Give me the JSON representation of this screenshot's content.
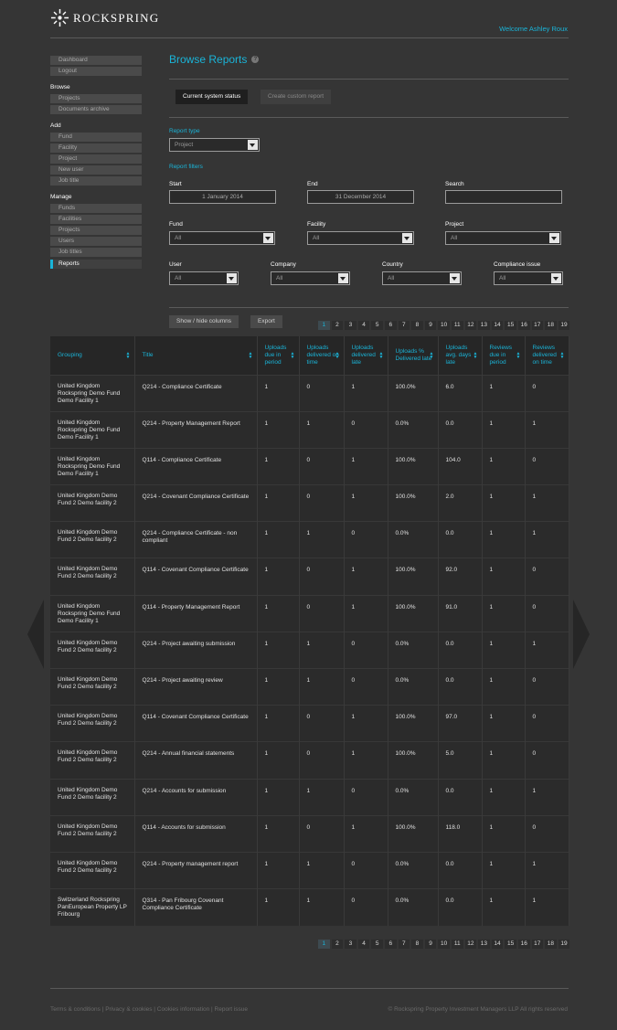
{
  "brand": {
    "name": "ROCKSPRING"
  },
  "header": {
    "welcome": "Welcome Ashley Roux"
  },
  "sidebar": {
    "top_items": [
      "Dashboard",
      "Logout"
    ],
    "browse_label": "Browse",
    "browse_items": [
      "Projects",
      "Documents archive"
    ],
    "add_label": "Add",
    "add_items": [
      "Fund",
      "Facility",
      "Project",
      "New user",
      "Job title"
    ],
    "manage_label": "Manage",
    "manage_items": [
      "Funds",
      "Facilities",
      "Projects",
      "Users",
      "Job titles",
      "Reports"
    ],
    "active_item": "Reports"
  },
  "main": {
    "title": "Browse Reports",
    "help_icon": "?",
    "tabs": [
      "Current system status",
      "Create custom report"
    ],
    "report_type_label": "Report type",
    "report_type_value": "Project",
    "report_filters_label": "Report filters",
    "filters": {
      "start_label": "Start",
      "start_value": "1 January 2014",
      "end_label": "End",
      "end_value": "31 December 2014",
      "search_label": "Search",
      "search_value": "",
      "fund_label": "Fund",
      "fund_value": "All",
      "facility_label": "Facility",
      "facility_value": "All",
      "project_label": "Project",
      "project_value": "All",
      "user_label": "User",
      "user_value": "All",
      "company_label": "Company",
      "company_value": "All",
      "country_label": "Country",
      "country_value": "All",
      "compliance_label": "Compliance issue",
      "compliance_value": "All"
    },
    "show_hide_label": "Show / hide columns",
    "export_label": "Export",
    "pages": [
      "1",
      "2",
      "3",
      "4",
      "5",
      "6",
      "7",
      "8",
      "9",
      "10",
      "11",
      "12",
      "13",
      "14",
      "15",
      "16",
      "17",
      "18",
      "19"
    ],
    "current_page": "1"
  },
  "table": {
    "columns": [
      "Grouping",
      "Title",
      "Uploads due in period",
      "Uploads delivered on time",
      "Uploads delivered late",
      "Uploads % Delivered late",
      "Uploads avg. days late",
      "Reviews due in period",
      "Reviews delivered on time"
    ],
    "rows": [
      [
        "United Kingdom Rockspring Demo Fund Demo Facility 1",
        "Q214 - Compliance Certificate",
        "1",
        "0",
        "1",
        "100.0%",
        "6.0",
        "1",
        "0"
      ],
      [
        "United Kingdom Rockspring Demo Fund Demo Facility 1",
        "Q214 - Property Management Report",
        "1",
        "1",
        "0",
        "0.0%",
        "0.0",
        "1",
        "1"
      ],
      [
        "United Kingdom Rockspring Demo Fund Demo Facility 1",
        "Q114 - Compliance Certificate",
        "1",
        "0",
        "1",
        "100.0%",
        "104.0",
        "1",
        "0"
      ],
      [
        "United Kingdom Demo Fund 2 Demo facility 2",
        "Q214 - Covenant Compliance Certificate",
        "1",
        "0",
        "1",
        "100.0%",
        "2.0",
        "1",
        "1"
      ],
      [
        "United Kingdom Demo Fund 2 Demo facility 2",
        "Q214 - Compliance Certificate - non compliant",
        "1",
        "1",
        "0",
        "0.0%",
        "0.0",
        "1",
        "1"
      ],
      [
        "United Kingdom Demo Fund 2 Demo facility 2",
        "Q114 - Covenant Compliance Certificate",
        "1",
        "0",
        "1",
        "100.0%",
        "92.0",
        "1",
        "0"
      ],
      [
        "United Kingdom Rockspring Demo Fund Demo Facility 1",
        "Q114 - Property Management Report",
        "1",
        "0",
        "1",
        "100.0%",
        "91.0",
        "1",
        "0"
      ],
      [
        "United Kingdom Demo Fund 2 Demo facility 2",
        "Q214 - Project awaiting submission",
        "1",
        "1",
        "0",
        "0.0%",
        "0.0",
        "1",
        "1"
      ],
      [
        "United Kingdom Demo Fund 2 Demo facility 2",
        "Q214 - Project awaiting review",
        "1",
        "1",
        "0",
        "0.0%",
        "0.0",
        "1",
        "0"
      ],
      [
        "United Kingdom Demo Fund 2 Demo facility 2",
        "Q114 - Covenant Compliance Certificate",
        "1",
        "0",
        "1",
        "100.0%",
        "97.0",
        "1",
        "0"
      ],
      [
        "United Kingdom Demo Fund 2 Demo facility 2",
        "Q214 - Annual financial statements",
        "1",
        "0",
        "1",
        "100.0%",
        "5.0",
        "1",
        "0"
      ],
      [
        "United Kingdom Demo Fund 2 Demo facility 2",
        "Q214 - Accounts for submission",
        "1",
        "1",
        "0",
        "0.0%",
        "0.0",
        "1",
        "1"
      ],
      [
        "United Kingdom Demo Fund 2 Demo facility 2",
        "Q114 - Accounts for submission",
        "1",
        "0",
        "1",
        "100.0%",
        "118.0",
        "1",
        "0"
      ],
      [
        "United Kingdom Demo Fund 2 Demo facility 2",
        "Q214 - Property management report",
        "1",
        "1",
        "0",
        "0.0%",
        "0.0",
        "1",
        "1"
      ],
      [
        "Switzerland Rockspring PanEuropean Property LP Fribourg",
        "Q314 - Pan Fribourg Covenant Compliance Certificate",
        "1",
        "1",
        "0",
        "0.0%",
        "0.0",
        "1",
        "1"
      ]
    ]
  },
  "footer": {
    "links": "Terms & conditions | Privacy & cookies | Cookies information | Report issue",
    "copyright": "© Rockspring Property Investment Managers LLP All rights reserved"
  },
  "colors": {
    "accent": "#1ab4d8",
    "background": "#353535"
  },
  "icons": {
    "prev": "chevron-left-icon",
    "next": "chevron-right-icon",
    "sort": "sort-icon",
    "dropdown": "dropdown-arrow-icon",
    "help": "help-icon"
  }
}
